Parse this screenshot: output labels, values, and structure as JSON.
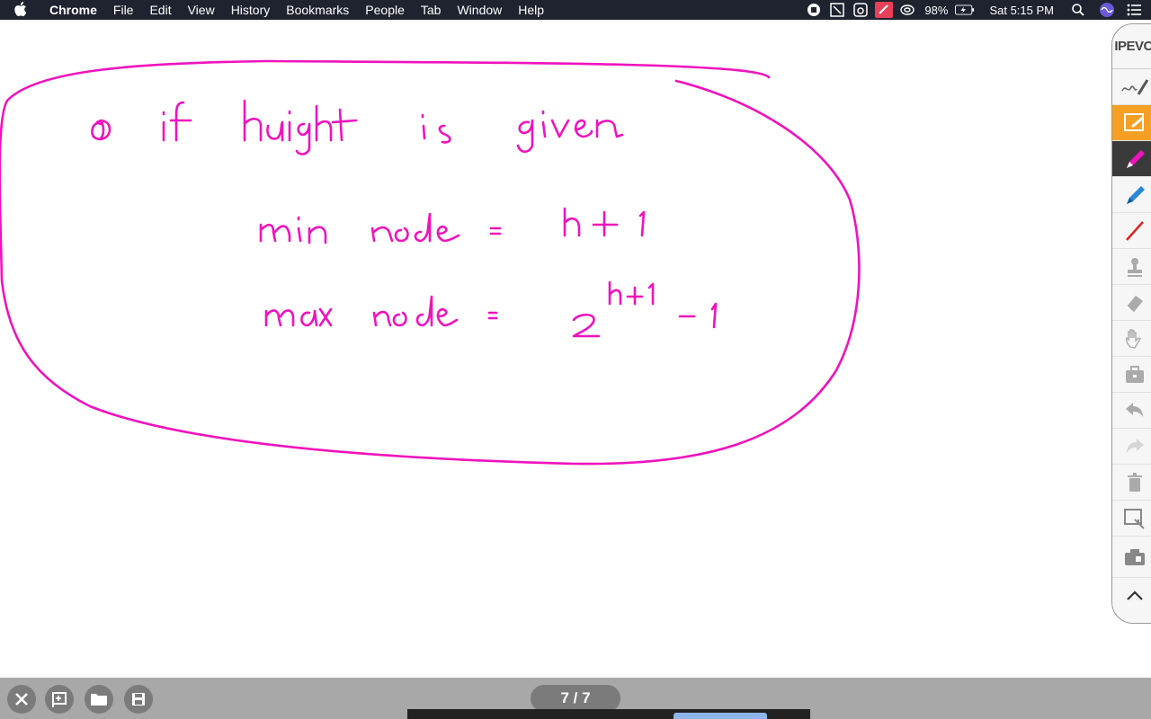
{
  "menubar": {
    "items": [
      "Chrome",
      "File",
      "Edit",
      "View",
      "History",
      "Bookmarks",
      "People",
      "Tab",
      "Window",
      "Help"
    ],
    "battery": "98%",
    "clock": "Sat 5:15 PM"
  },
  "toolbar": {
    "logo": "IPEVO"
  },
  "bottombar": {
    "page_indicator": "7 / 7"
  },
  "colors": {
    "ink": "#f012be",
    "menubar": "#1f2330",
    "toolbar_active": "#f5a024"
  }
}
